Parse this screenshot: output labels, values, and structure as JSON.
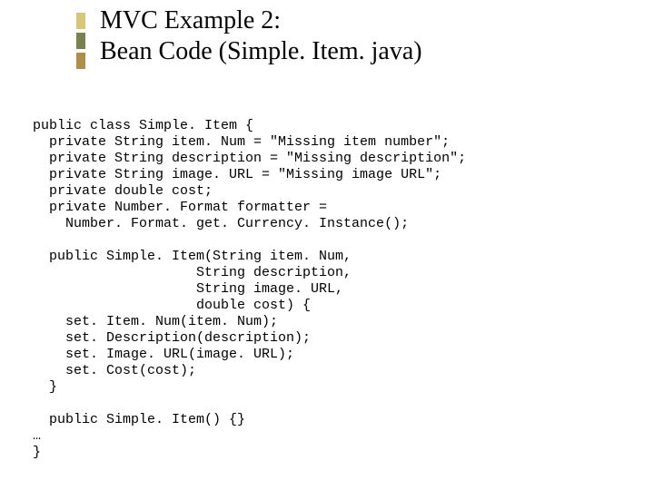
{
  "title": {
    "line1": "MVC Example 2:",
    "line2": "Bean Code (Simple. Item. java)"
  },
  "code": {
    "l1": "public class Simple. Item {",
    "l2": "  private String item. Num = \"Missing item number\";",
    "l3": "  private String description = \"Missing description\";",
    "l4": "  private String image. URL = \"Missing image URL\";",
    "l5": "  private double cost;",
    "l6": "  private Number. Format formatter =",
    "l7": "    Number. Format. get. Currency. Instance();",
    "l8": "",
    "l9": "  public Simple. Item(String item. Num,",
    "l10": "                    String description,",
    "l11": "                    String image. URL,",
    "l12": "                    double cost) {",
    "l13": "    set. Item. Num(item. Num);",
    "l14": "    set. Description(description);",
    "l15": "    set. Image. URL(image. URL);",
    "l16": "    set. Cost(cost);",
    "l17": "  }",
    "l18": "",
    "l19": "  public Simple. Item() {}",
    "l20": "…",
    "l21": "}"
  }
}
